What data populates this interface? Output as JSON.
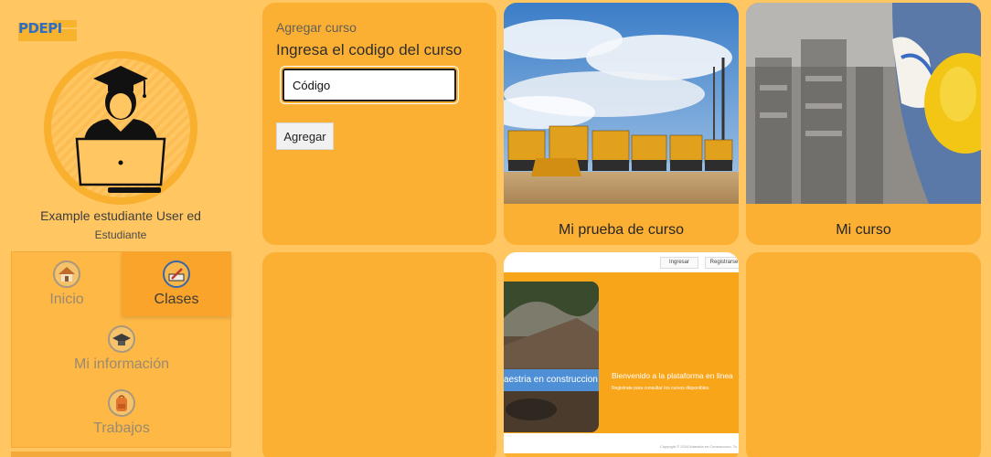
{
  "logo": {
    "text": "PDEPI"
  },
  "user": {
    "name": "Example estudiante User ed",
    "role": "Estudiante"
  },
  "nav": {
    "inicio": "Inicio",
    "clases": "Clases",
    "info": "Mi información",
    "trabajos": "Trabajos"
  },
  "add_course": {
    "title": "Agregar curso",
    "subtitle": "Ingresa el codigo del curso",
    "input_value": "Código",
    "button": "Agregar"
  },
  "courses": [
    {
      "label": "Mi prueba de curso"
    },
    {
      "label": "Mi curso"
    }
  ],
  "preview": {
    "login": "Ingresar",
    "register": "Registrarse",
    "caption": "aestria en construccion",
    "welcome": "Bienvenido a la plataforma en linea",
    "register_note": "Registrate para consultar los cursos disponibles.",
    "copyright": "Copyright © 2024 Maestria en Construccion. To"
  },
  "colors": {
    "background": "#ffc661",
    "card": "#fbb034",
    "accent": "#f9a51a",
    "logo_blue": "#2f6fc3"
  }
}
